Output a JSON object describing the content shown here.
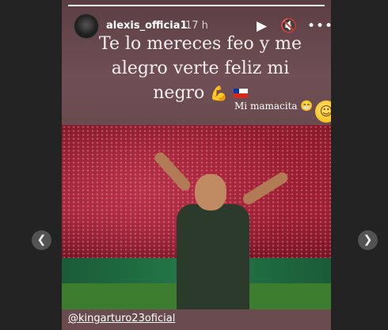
{
  "story": {
    "username": "alexis_officia1",
    "timestamp": "17 h",
    "progress": 1.0,
    "controls": {
      "play_icon": "play-icon",
      "mute_icon": "mute-icon",
      "more_icon": "more-icon"
    },
    "caption": {
      "line1": "Te lo mereces feo y me",
      "line2": "alegro  verte feliz mi",
      "line3": "negro"
    },
    "reply": "Mi mamacita",
    "mention": "@kingarturo23oficial"
  },
  "colors": {
    "story_bg": "#6a4b50",
    "backdrop": "#232323"
  }
}
